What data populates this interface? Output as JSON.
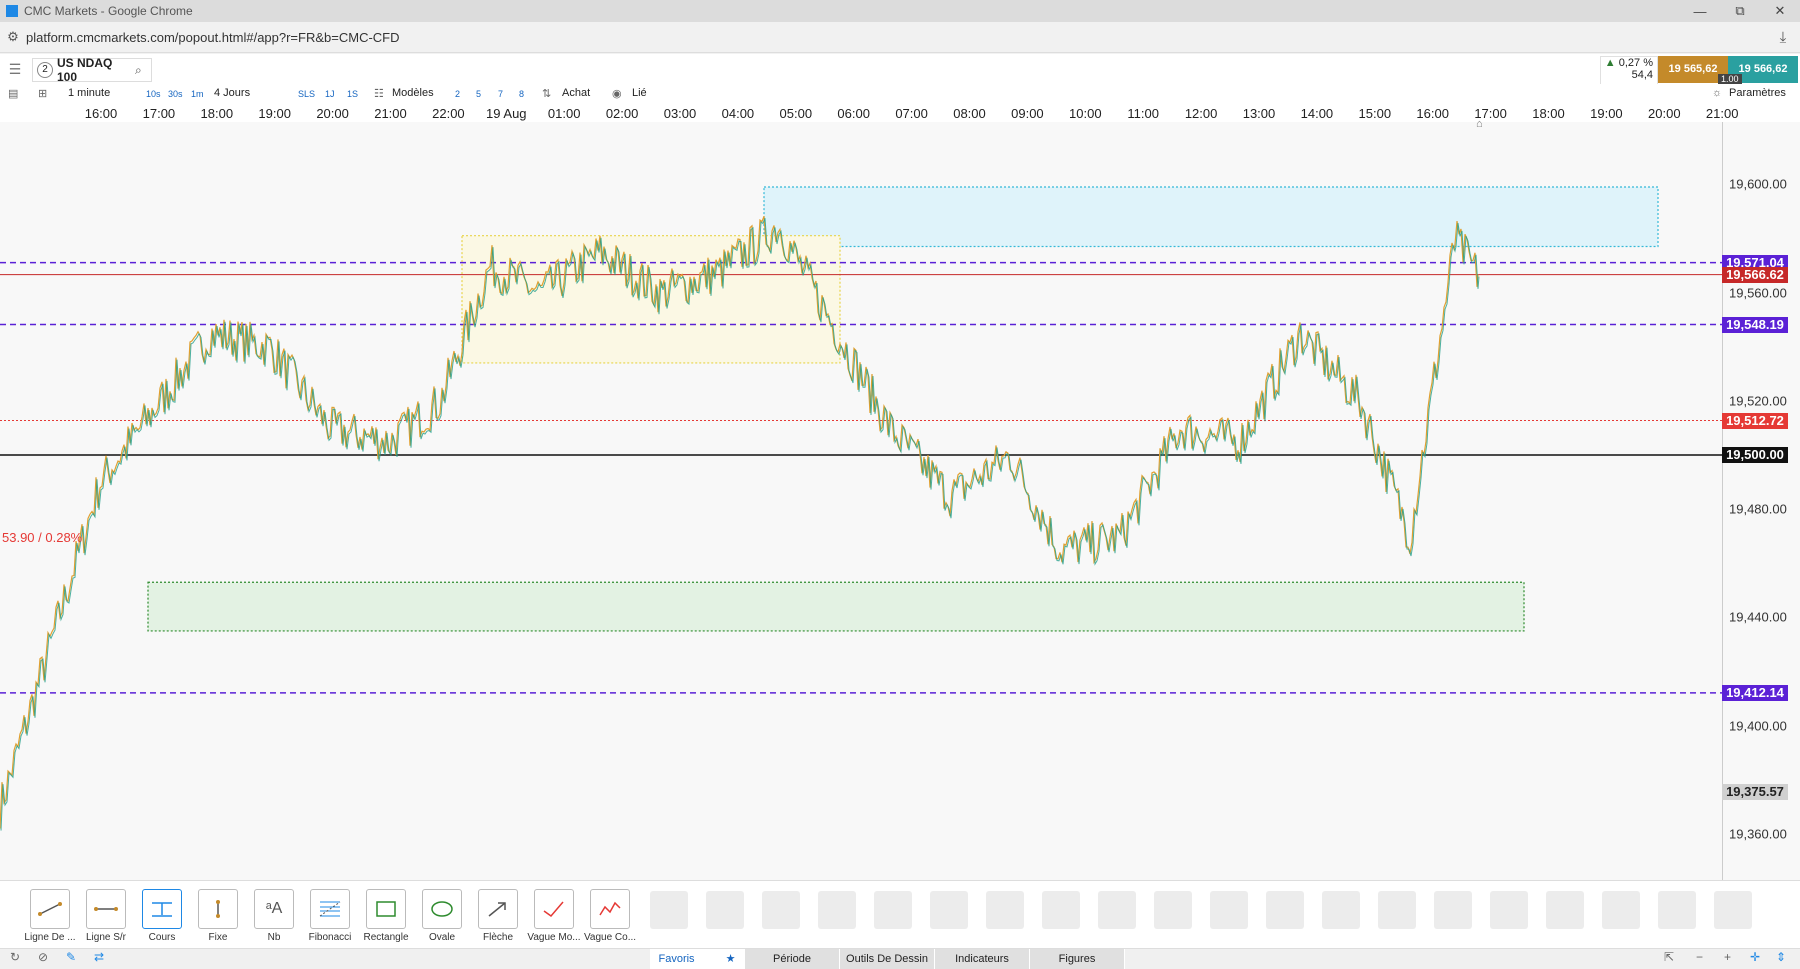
{
  "window": {
    "title": "CMC Markets - Google Chrome",
    "minimize": "—",
    "restore": "⧉",
    "close": "✕"
  },
  "browser": {
    "url": "platform.cmcmarkets.com/popout.html#/app?r=FR&b=CMC-CFD"
  },
  "instrument": {
    "index": "2",
    "name": "US NDAQ 100"
  },
  "quote": {
    "change_pct": "0,27 %",
    "change_pts": "54,4",
    "sell": "19 565,62",
    "buy": "19 566,62",
    "spread": "1.00"
  },
  "toolbar": {
    "interval": "1 minute",
    "intervals": [
      "10s",
      "30s",
      "1m"
    ],
    "range": "4 Jours",
    "sl_toggles": [
      "SLS",
      "1J",
      "1S"
    ],
    "templates": "Modèles",
    "counts": [
      "2",
      "5",
      "7",
      "8"
    ],
    "side": "Achat",
    "linked": "Lié",
    "settings": "Paramètres"
  },
  "x_axis": {
    "ticks": [
      "16:00",
      "17:00",
      "18:00",
      "19:00",
      "20:00",
      "21:00",
      "22:00",
      "19 Aug",
      "01:00",
      "02:00",
      "03:00",
      "04:00",
      "05:00",
      "06:00",
      "07:00",
      "08:00",
      "09:00",
      "10:00",
      "11:00",
      "12:00",
      "13:00",
      "14:00",
      "15:00",
      "16:00",
      "17:00",
      "18:00",
      "19:00",
      "20:00",
      "21:00"
    ]
  },
  "y_axis": {
    "ticks": [
      "19,600.00",
      "19,560.00",
      "19,520.00",
      "19,480.00",
      "19,440.00",
      "19,400.00",
      "19,360.00"
    ],
    "min": 19343,
    "max": 19623
  },
  "levels": [
    {
      "value": "19,571.04",
      "num": 19571.04,
      "color": "#5b21d6",
      "style": "dashed"
    },
    {
      "value": "19,566.62",
      "num": 19566.62,
      "color": "#c62828",
      "style": "current"
    },
    {
      "value": "19,548.19",
      "num": 19548.19,
      "color": "#5b21d6",
      "style": "dashed"
    },
    {
      "value": "19,512.72",
      "num": 19512.72,
      "color": "#e53935",
      "style": "dotted"
    },
    {
      "value": "19,500.00",
      "num": 19500.0,
      "color": "#111111",
      "style": "solid"
    },
    {
      "value": "19,412.14",
      "num": 19412.14,
      "color": "#5b21d6",
      "style": "dashed"
    },
    {
      "value": "19,375.57",
      "num": 19375.57,
      "color": "#333333",
      "style": "low"
    }
  ],
  "gap_label": "53.90 / 0.28%",
  "zones": [
    {
      "name": "resistance",
      "fill": "#dff3fa",
      "stroke": "#35b9d8"
    },
    {
      "name": "consolidation",
      "fill": "#fbf8e4",
      "stroke": "#e8d44a"
    },
    {
      "name": "support",
      "fill": "#e3f2e3",
      "stroke": "#2e8b2e"
    }
  ],
  "chart_data": {
    "type": "line",
    "instrument": "US NDAQ 100",
    "interval": "1 minute",
    "x": [
      "16:00",
      "17:00",
      "18:00",
      "19:00",
      "20:00",
      "21:00",
      "22:00",
      "00:00",
      "01:00",
      "02:00",
      "03:00",
      "04:00",
      "05:00",
      "06:00",
      "07:00",
      "08:00",
      "09:00",
      "10:00",
      "11:00",
      "12:00",
      "13:00",
      "14:00",
      "15:00",
      "16:00",
      "16:40",
      "17:00"
    ],
    "series": [
      {
        "values": [
          19370,
          19490,
          19545,
          19540,
          19510,
          19505,
          19520,
          19570,
          19560,
          19575,
          19560,
          19568,
          19585,
          19550,
          19510,
          19485,
          19500,
          19465,
          19470,
          19510,
          19505,
          19545,
          19520,
          19470,
          19580,
          19566.62
        ]
      }
    ],
    "ylim": [
      19343,
      19623
    ]
  },
  "drawing_tools": [
    {
      "label": "Ligne De ...",
      "icon": "trend-line-icon"
    },
    {
      "label": "Ligne S/r",
      "icon": "horizontal-line-icon"
    },
    {
      "label": "Cours",
      "icon": "price-icon"
    },
    {
      "label": "Fixe",
      "icon": "vertical-line-icon"
    },
    {
      "label": "Nb",
      "icon": "text-icon"
    },
    {
      "label": "Fibonacci",
      "icon": "fibonacci-icon"
    },
    {
      "label": "Rectangle",
      "icon": "rectangle-icon"
    },
    {
      "label": "Ovale",
      "icon": "oval-icon"
    },
    {
      "label": "Flèche",
      "icon": "arrow-icon"
    },
    {
      "label": "Vague Mo...",
      "icon": "wave-motive-icon"
    },
    {
      "label": "Vague Co...",
      "icon": "wave-corrective-icon"
    }
  ],
  "bottom_tabs": [
    "Favoris",
    "Période",
    "Outils De Dessin",
    "Indicateurs",
    "Figures"
  ]
}
